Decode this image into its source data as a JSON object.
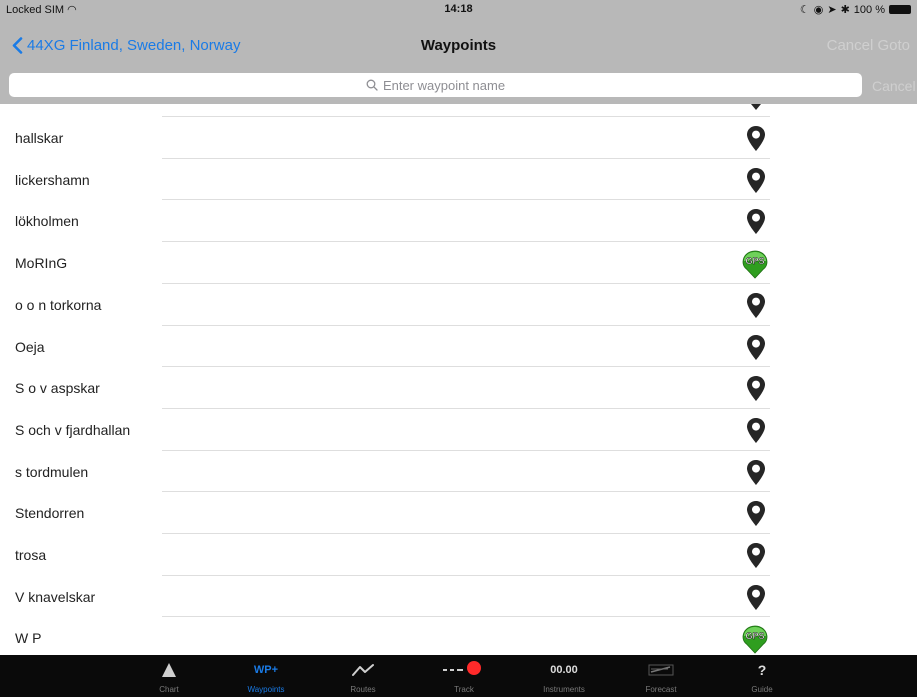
{
  "status_bar": {
    "carrier": "Locked SIM",
    "time": "14:18",
    "battery": "100 %"
  },
  "nav": {
    "back_label": "44XG Finland, Sweden, Norway",
    "title": "Waypoints",
    "cancel_goto": "Cancel Goto"
  },
  "search": {
    "placeholder": "Enter waypoint name",
    "cancel": "Cancel"
  },
  "waypoints": [
    {
      "name": "hallskar",
      "icon": "pin-icon"
    },
    {
      "name": "lickershamn",
      "icon": "pin-icon"
    },
    {
      "name": "lökholmen",
      "icon": "pin-icon"
    },
    {
      "name": "MoRInG",
      "icon": "gps-icon"
    },
    {
      "name": "o o n torkorna",
      "icon": "pin-icon"
    },
    {
      "name": "Oeja",
      "icon": "pin-icon"
    },
    {
      "name": "S o v aspskar",
      "icon": "pin-icon"
    },
    {
      "name": "S och v fjardhallan",
      "icon": "pin-icon"
    },
    {
      "name": "s tordmulen",
      "icon": "pin-icon"
    },
    {
      "name": "Stendorren",
      "icon": "pin-icon"
    },
    {
      "name": "trosa",
      "icon": "pin-icon"
    },
    {
      "name": "V knavelskar",
      "icon": "pin-icon"
    },
    {
      "name": "W P",
      "icon": "gps-icon"
    }
  ],
  "gps_badge_text": "GPS",
  "tabs": [
    {
      "label": "Chart",
      "icon": "chart-triangle-icon",
      "active": false
    },
    {
      "label": "Waypoints",
      "icon": "waypoint-add-icon",
      "icon_text": "WP+",
      "active": true
    },
    {
      "label": "Routes",
      "icon": "route-line-icon",
      "active": false
    },
    {
      "label": "Track",
      "icon": "track-record-icon",
      "active": false
    },
    {
      "label": "Instruments",
      "icon": "instruments-icon",
      "icon_text": "00.00",
      "active": false
    },
    {
      "label": "Forecast",
      "icon": "forecast-icon",
      "active": false
    },
    {
      "label": "Guide",
      "icon": "guide-icon",
      "icon_text": "?",
      "active": false
    }
  ],
  "colors": {
    "accent": "#1a7be6",
    "bar_gray": "#b8b8b8",
    "tab_bar": "#0a0a0a",
    "record_red": "#ff2a2a",
    "gps_green": "#2f9e1f"
  }
}
